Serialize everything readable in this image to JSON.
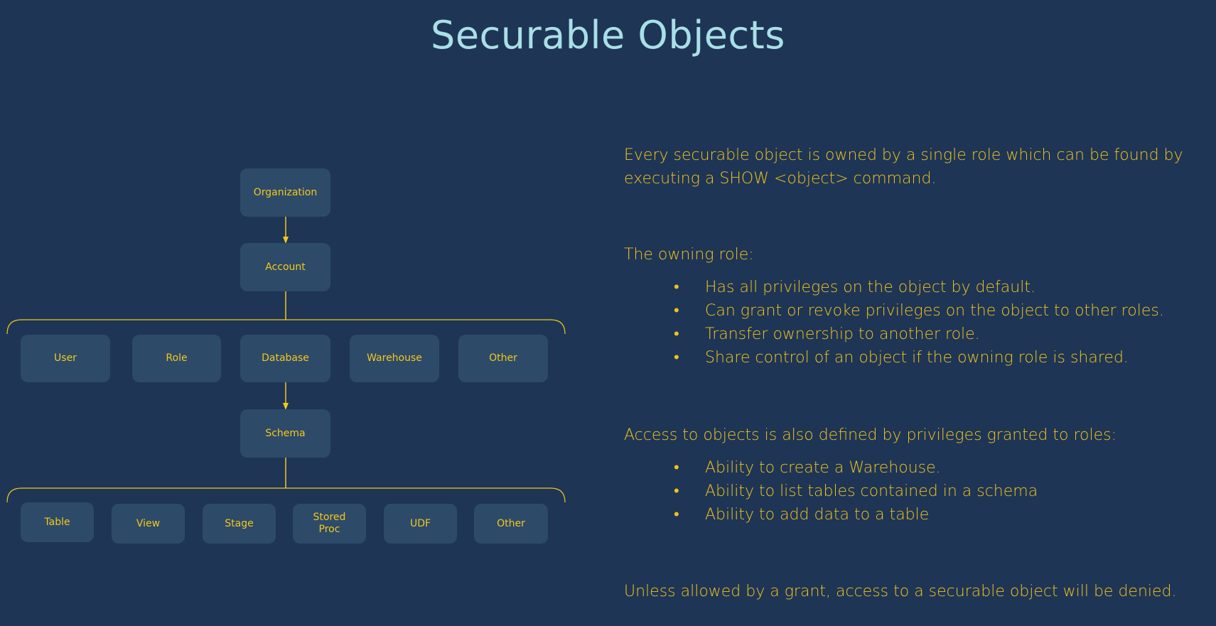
{
  "title": "Securable Objects",
  "colors": {
    "background": "#1e3556",
    "title": "#a9dfe6",
    "node_fill": "#2d4a69",
    "accent": "#f4c81a"
  },
  "diagram": {
    "organization": "Organization",
    "account": "Account",
    "account_children": [
      "User",
      "Role",
      "Database",
      "Warehouse",
      "Other"
    ],
    "schema": "Schema",
    "schema_children": [
      "Table",
      "View",
      "Stage",
      "Stored\nProc",
      "UDF",
      "Other"
    ]
  },
  "text": {
    "intro": "Every securable object is owned by a single role which can be found by executing a SHOW <object> command.",
    "owning_heading": "The owning role:",
    "owning_bullets": [
      "Has all privileges on the object by default.",
      "Can grant or revoke privileges on the object to other roles.",
      "Transfer ownership to another role.",
      "Share control of an object if the owning role is shared."
    ],
    "access_heading": "Access to objects is also defined by privileges granted to roles:",
    "access_bullets": [
      "Ability to create a Warehouse.",
      "Ability to list tables contained in a schema",
      "Ability to add data to a table"
    ],
    "conclusion": "Unless allowed by a grant, access to a securable object will be denied."
  }
}
